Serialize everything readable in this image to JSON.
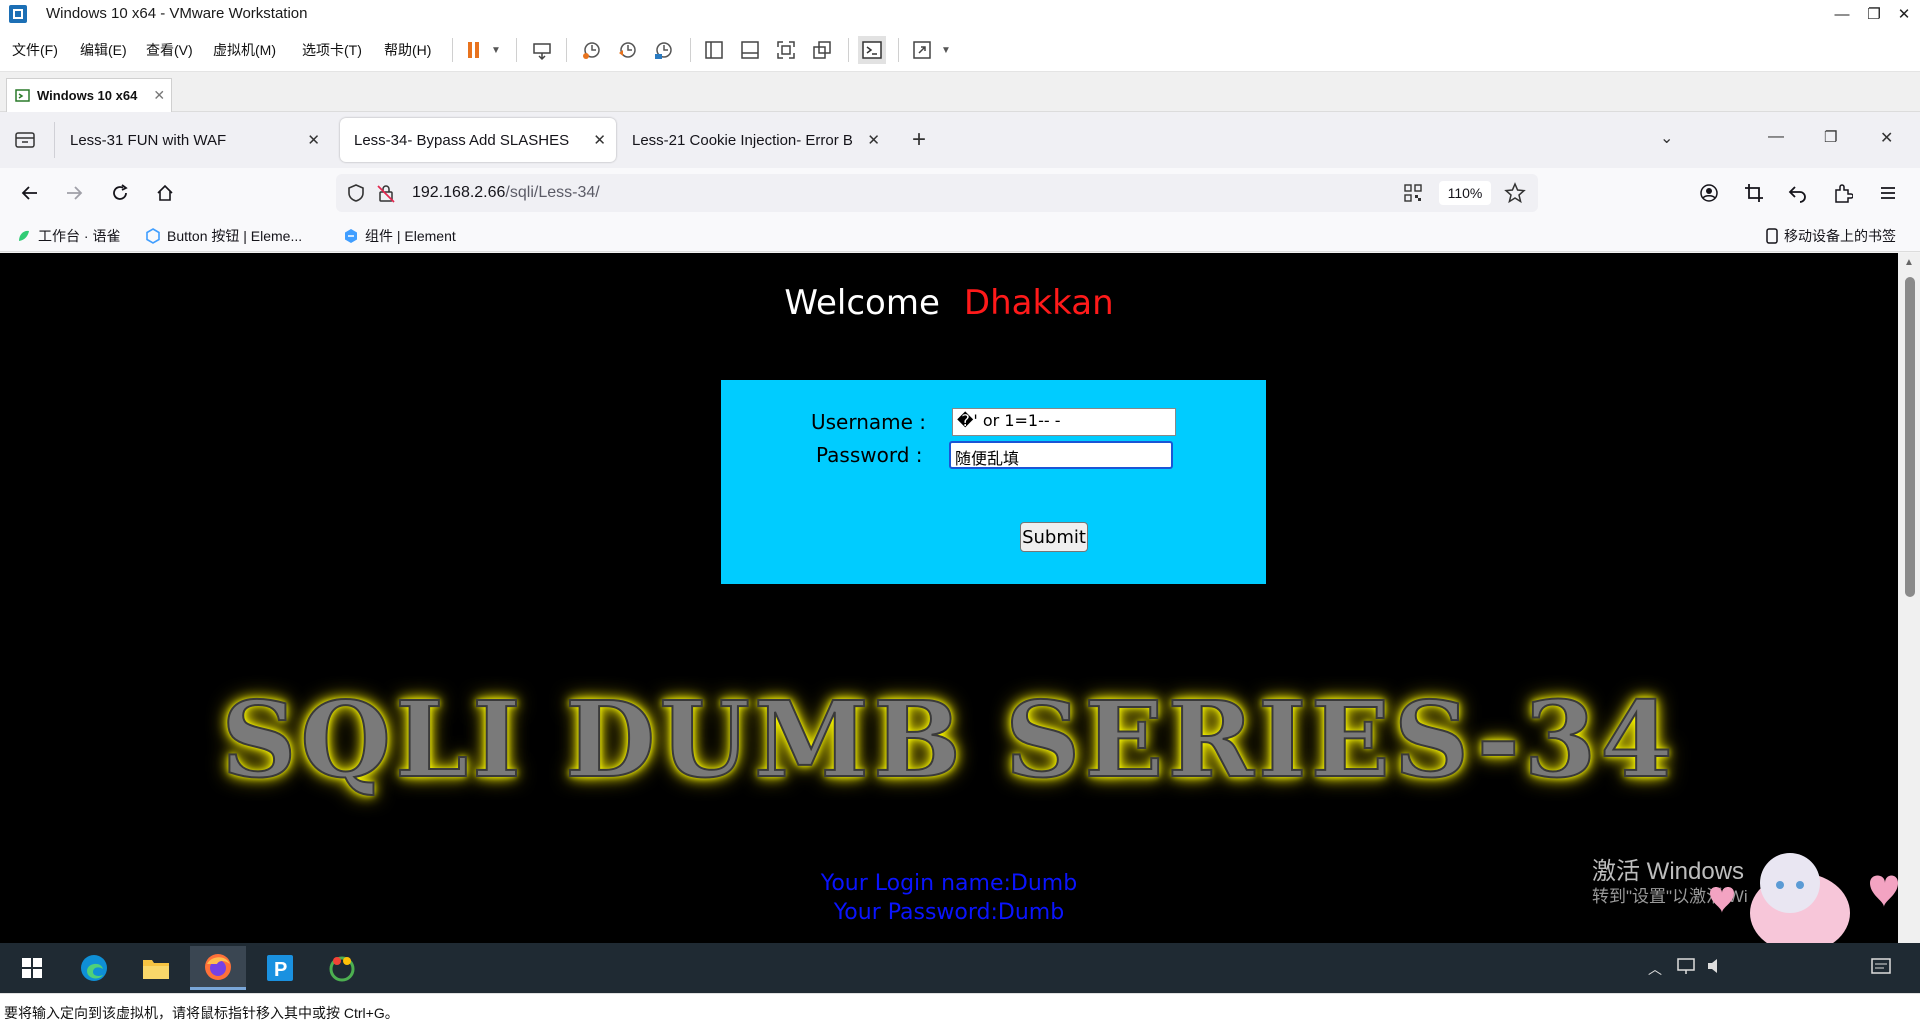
{
  "vmware": {
    "title": "Windows 10 x64 - VMware Workstation",
    "menu": [
      "文件(F)",
      "编辑(E)",
      "查看(V)",
      "虚拟机(M)",
      "选项卡(T)",
      "帮助(H)"
    ],
    "tab_label": "Windows 10 x64",
    "status": "要将输入定向到该虚拟机，请将鼠标指针移入其中或按 Ctrl+G。"
  },
  "firefox": {
    "tabs": [
      {
        "label": "Less-31 FUN with WAF"
      },
      {
        "label": "Less-34- Bypass Add SLASHES"
      },
      {
        "label": "Less-21 Cookie Injection- Error B"
      }
    ],
    "url_host": "192.168.2.66",
    "url_path": "/sqli/Less-34/",
    "zoom": "110%",
    "bookmarks": [
      "工作台 · 语雀",
      "Button 按钮 | Eleme...",
      "组件 | Element"
    ],
    "mobile_bookmarks": "移动设备上的书签"
  },
  "page": {
    "welcome": "Welcome",
    "name": "Dhakkan",
    "username_label": "Username :",
    "password_label": "Password :",
    "username_value": "�' or 1=1-- -",
    "password_value": "随便乱填",
    "submit": "Submit",
    "banner": "SQLI DUMB SERIES-34",
    "login_name": "Your Login name:Dumb",
    "login_password": "Your Password:Dumb",
    "activate_title": "激活 Windows",
    "activate_sub": "转到\"设置\"以激活 Wi"
  },
  "colors": {
    "login_box": "#00ccff",
    "name_red": "#ff1a1a",
    "result_blue": "#0a14ff"
  },
  "icons": [
    "vmware-icon",
    "pause-icon",
    "snapshot-icon",
    "fullscreen-icon",
    "back-arrow-icon",
    "forward-arrow-icon",
    "reload-icon",
    "home-icon",
    "shield-icon",
    "lock-slash-icon",
    "qr-icon",
    "star-icon",
    "account-icon",
    "extensions-icon",
    "menu-icon",
    "windows-start-icon",
    "edge-icon",
    "explorer-icon",
    "firefox-icon",
    "pycharm-icon"
  ]
}
